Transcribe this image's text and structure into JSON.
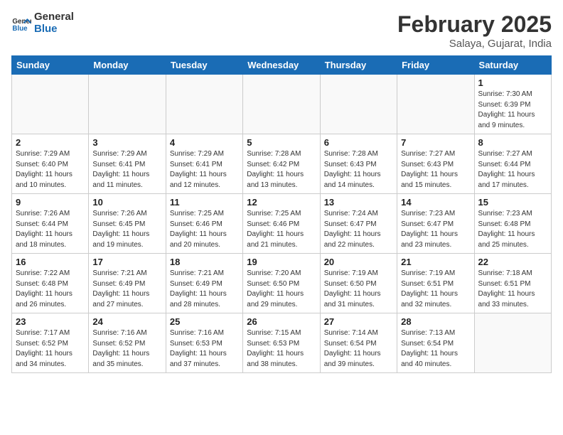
{
  "header": {
    "logo_general": "General",
    "logo_blue": "Blue",
    "month_year": "February 2025",
    "location": "Salaya, Gujarat, India"
  },
  "weekdays": [
    "Sunday",
    "Monday",
    "Tuesday",
    "Wednesday",
    "Thursday",
    "Friday",
    "Saturday"
  ],
  "weeks": [
    [
      {
        "day": "",
        "info": ""
      },
      {
        "day": "",
        "info": ""
      },
      {
        "day": "",
        "info": ""
      },
      {
        "day": "",
        "info": ""
      },
      {
        "day": "",
        "info": ""
      },
      {
        "day": "",
        "info": ""
      },
      {
        "day": "1",
        "info": "Sunrise: 7:30 AM\nSunset: 6:39 PM\nDaylight: 11 hours\nand 9 minutes."
      }
    ],
    [
      {
        "day": "2",
        "info": "Sunrise: 7:29 AM\nSunset: 6:40 PM\nDaylight: 11 hours\nand 10 minutes."
      },
      {
        "day": "3",
        "info": "Sunrise: 7:29 AM\nSunset: 6:41 PM\nDaylight: 11 hours\nand 11 minutes."
      },
      {
        "day": "4",
        "info": "Sunrise: 7:29 AM\nSunset: 6:41 PM\nDaylight: 11 hours\nand 12 minutes."
      },
      {
        "day": "5",
        "info": "Sunrise: 7:28 AM\nSunset: 6:42 PM\nDaylight: 11 hours\nand 13 minutes."
      },
      {
        "day": "6",
        "info": "Sunrise: 7:28 AM\nSunset: 6:43 PM\nDaylight: 11 hours\nand 14 minutes."
      },
      {
        "day": "7",
        "info": "Sunrise: 7:27 AM\nSunset: 6:43 PM\nDaylight: 11 hours\nand 15 minutes."
      },
      {
        "day": "8",
        "info": "Sunrise: 7:27 AM\nSunset: 6:44 PM\nDaylight: 11 hours\nand 17 minutes."
      }
    ],
    [
      {
        "day": "9",
        "info": "Sunrise: 7:26 AM\nSunset: 6:44 PM\nDaylight: 11 hours\nand 18 minutes."
      },
      {
        "day": "10",
        "info": "Sunrise: 7:26 AM\nSunset: 6:45 PM\nDaylight: 11 hours\nand 19 minutes."
      },
      {
        "day": "11",
        "info": "Sunrise: 7:25 AM\nSunset: 6:46 PM\nDaylight: 11 hours\nand 20 minutes."
      },
      {
        "day": "12",
        "info": "Sunrise: 7:25 AM\nSunset: 6:46 PM\nDaylight: 11 hours\nand 21 minutes."
      },
      {
        "day": "13",
        "info": "Sunrise: 7:24 AM\nSunset: 6:47 PM\nDaylight: 11 hours\nand 22 minutes."
      },
      {
        "day": "14",
        "info": "Sunrise: 7:23 AM\nSunset: 6:47 PM\nDaylight: 11 hours\nand 23 minutes."
      },
      {
        "day": "15",
        "info": "Sunrise: 7:23 AM\nSunset: 6:48 PM\nDaylight: 11 hours\nand 25 minutes."
      }
    ],
    [
      {
        "day": "16",
        "info": "Sunrise: 7:22 AM\nSunset: 6:48 PM\nDaylight: 11 hours\nand 26 minutes."
      },
      {
        "day": "17",
        "info": "Sunrise: 7:21 AM\nSunset: 6:49 PM\nDaylight: 11 hours\nand 27 minutes."
      },
      {
        "day": "18",
        "info": "Sunrise: 7:21 AM\nSunset: 6:49 PM\nDaylight: 11 hours\nand 28 minutes."
      },
      {
        "day": "19",
        "info": "Sunrise: 7:20 AM\nSunset: 6:50 PM\nDaylight: 11 hours\nand 29 minutes."
      },
      {
        "day": "20",
        "info": "Sunrise: 7:19 AM\nSunset: 6:50 PM\nDaylight: 11 hours\nand 31 minutes."
      },
      {
        "day": "21",
        "info": "Sunrise: 7:19 AM\nSunset: 6:51 PM\nDaylight: 11 hours\nand 32 minutes."
      },
      {
        "day": "22",
        "info": "Sunrise: 7:18 AM\nSunset: 6:51 PM\nDaylight: 11 hours\nand 33 minutes."
      }
    ],
    [
      {
        "day": "23",
        "info": "Sunrise: 7:17 AM\nSunset: 6:52 PM\nDaylight: 11 hours\nand 34 minutes."
      },
      {
        "day": "24",
        "info": "Sunrise: 7:16 AM\nSunset: 6:52 PM\nDaylight: 11 hours\nand 35 minutes."
      },
      {
        "day": "25",
        "info": "Sunrise: 7:16 AM\nSunset: 6:53 PM\nDaylight: 11 hours\nand 37 minutes."
      },
      {
        "day": "26",
        "info": "Sunrise: 7:15 AM\nSunset: 6:53 PM\nDaylight: 11 hours\nand 38 minutes."
      },
      {
        "day": "27",
        "info": "Sunrise: 7:14 AM\nSunset: 6:54 PM\nDaylight: 11 hours\nand 39 minutes."
      },
      {
        "day": "28",
        "info": "Sunrise: 7:13 AM\nSunset: 6:54 PM\nDaylight: 11 hours\nand 40 minutes."
      },
      {
        "day": "",
        "info": ""
      }
    ]
  ]
}
